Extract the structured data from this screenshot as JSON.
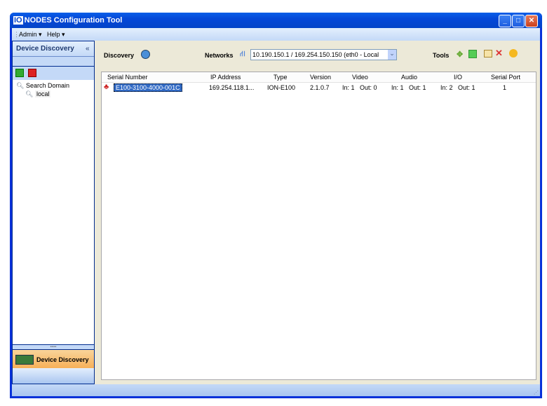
{
  "window": {
    "logo": "IO",
    "title": "NODES  Configuration Tool",
    "min": "_",
    "max": "□",
    "close": "✕"
  },
  "menu": {
    "admin": "Admin",
    "help": "Help"
  },
  "left": {
    "header": "Device Discovery",
    "collapse": "«",
    "tree_root": "Search Domain",
    "tree_child": "local",
    "nav_button": "Device Discovery"
  },
  "toolbar": {
    "discovery": "Discovery",
    "networks": "Networks",
    "network_value": "10.190.150.1 / 169.254.150.150 (eth0 - Local",
    "tools": "Tools"
  },
  "table": {
    "columns": [
      "Serial Number",
      "IP Address",
      "Type",
      "Version",
      "Video",
      "Audio",
      "I/O",
      "Serial Port"
    ],
    "rows": [
      {
        "serial": "E100-3100-4000-001C",
        "ip": "169.254.118.1...",
        "type": "ION-E100",
        "version": "2.1.0.7",
        "video": "In: 1   Out: 0",
        "audio": "In: 1   Out: 1",
        "io": "In: 2   Out: 1",
        "serial_port": "1"
      }
    ]
  }
}
